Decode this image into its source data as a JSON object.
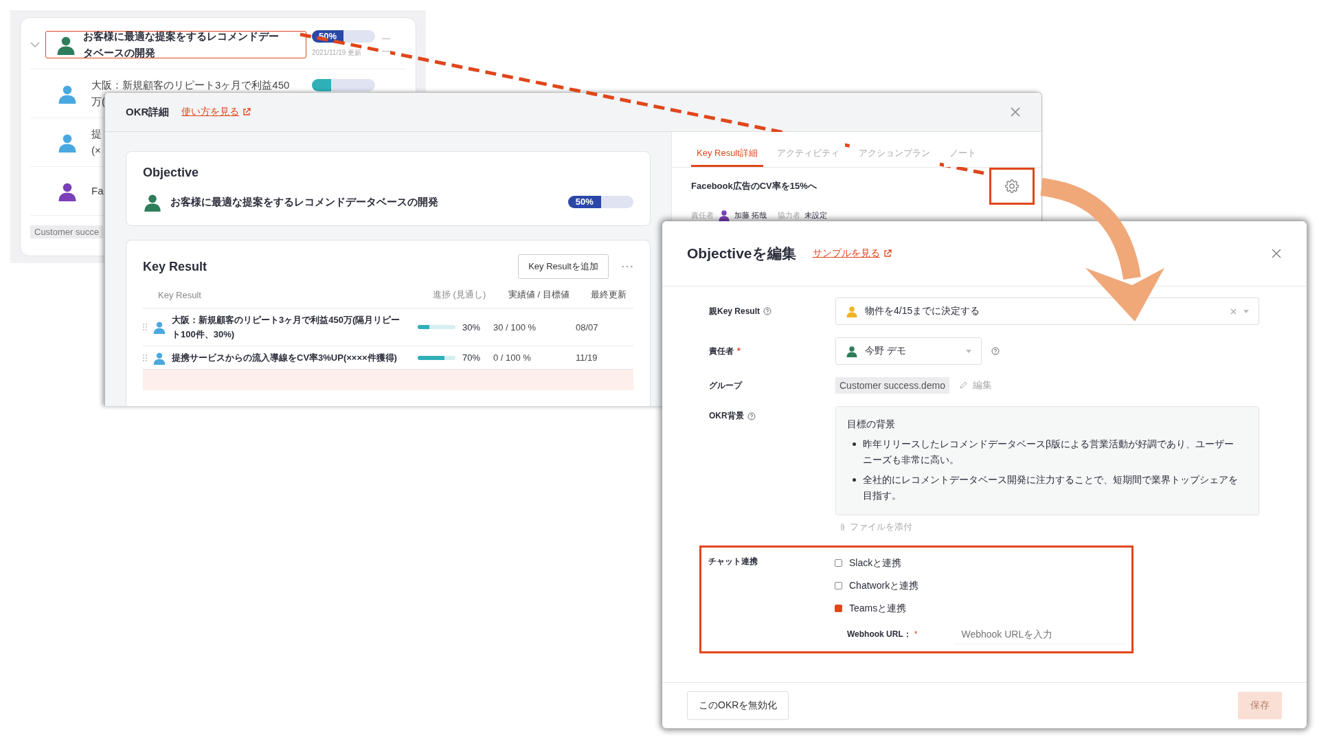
{
  "background_list": {
    "rows": [
      {
        "lines": [
          "お客様に最適な提案をするレコメンドデー",
          "タベースの開発"
        ],
        "selected": true,
        "expanded": true,
        "color": "#2e7d5b",
        "progress": {
          "label": "50%",
          "level": 0.5,
          "color": "#2a47a8"
        },
        "updated": "2021/11/19 更新",
        "dashes": [
          "—",
          "—"
        ]
      },
      {
        "lines": [
          "大阪：新規顧客のリピート3ヶ月で利益450",
          "万("
        ],
        "selected": false,
        "color": "#4aa8e0",
        "progress": {
          "level": 0.3,
          "color": "#2fb0b8"
        }
      },
      {
        "lines": [
          "提",
          "(×"
        ],
        "selected": false,
        "color": "#4aa8e0"
      },
      {
        "lines": [
          "Fa"
        ],
        "selected": false,
        "color": "#7b3fb8"
      }
    ],
    "group_tag": "Customer succe"
  },
  "okr_detail": {
    "title": "OKR詳細",
    "link": "使い方を見る",
    "objective": {
      "heading": "Objective",
      "title": "お客様に最適な提案をするレコメンドデータベースの開発",
      "color": "#2e7d5b",
      "progress": {
        "label": "50%",
        "level": 0.5
      }
    },
    "key_results": {
      "heading": "Key Result",
      "add_button": "Key Resultを追加",
      "columns": [
        "Key Result",
        "進捗 (見通し)",
        "実績値 / 目標値",
        "最終更新"
      ],
      "rows": [
        {
          "title": "大阪：新規顧客のリピート3ヶ月で利益450万(隔月リピート100件、30%)",
          "color": "#4aa8e0",
          "progress": "30%",
          "level": 0.3,
          "value": "30 / 100 %",
          "updated": "08/07"
        },
        {
          "title": "提携サービスからの流入導線をCV率3%UP(××××件獲得)",
          "color": "#4aa8e0",
          "progress": "70%",
          "level": 0.7,
          "value": "0 / 100 %",
          "updated": "11/19"
        }
      ]
    },
    "tabs": [
      {
        "label": "Key Result詳細",
        "selected": true
      },
      {
        "label": "アクティビティ",
        "selected": false
      },
      {
        "label": "アクションプラン",
        "selected": false
      },
      {
        "label": "ノート",
        "selected": false
      }
    ],
    "kr_title": "Facebook広告のCV率を15%へ",
    "owner_label": "責任者",
    "owner": "加藤 拓哉",
    "collaborator_label": "協力者",
    "collaborator": "未設定"
  },
  "edit_modal": {
    "title": "Objectiveを編集",
    "link": "サンプルを見る",
    "parent_kr": {
      "label": "親Key Result",
      "value": "物件を4/15までに決定する",
      "color": "#f0b323"
    },
    "owner": {
      "label": "責任者",
      "required_mark": "*",
      "value": "今野 デモ",
      "color": "#2e7d5b"
    },
    "group": {
      "label": "グループ",
      "tag": "Customer success.demo",
      "edit": "編集"
    },
    "background": {
      "label": "OKR背景",
      "heading": "目標の背景",
      "bullets": [
        "昨年リリースしたレコメンドデータベースβ版による営業活動が好調であり、ユーザーニーズも非常に高い。",
        "全社的にレコメントデータベース開発に注力することで、短期間で業界トップシェアを目指す。"
      ]
    },
    "attach": "ファイルを添付",
    "chat": {
      "label": "チャット連携",
      "options": [
        {
          "label": "Slackと連携",
          "checked": false
        },
        {
          "label": "Chatworkと連携",
          "checked": false
        },
        {
          "label": "Teamsと連携",
          "checked": true
        }
      ],
      "webhook": {
        "label": "Webhook URL：",
        "required_mark": "*",
        "placeholder": "Webhook URLを入力"
      }
    },
    "disable_button": "このOKRを無効化",
    "save_button": {
      "label": "保存",
      "disabled": true
    }
  }
}
